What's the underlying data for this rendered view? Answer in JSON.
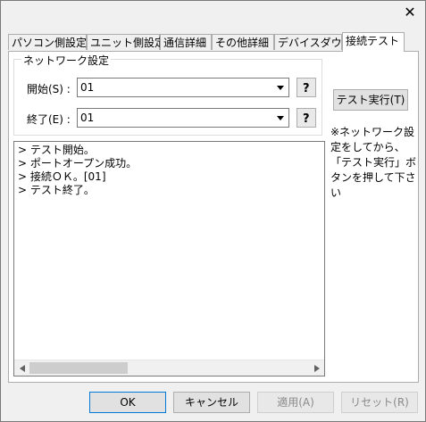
{
  "window": {
    "close_label": "✕"
  },
  "tabs": [
    {
      "label": "パソコン側設定"
    },
    {
      "label": "ユニット側設定"
    },
    {
      "label": "通信詳細"
    },
    {
      "label": "その他詳細"
    },
    {
      "label": "デバイスダウン"
    },
    {
      "label": "接続テスト"
    }
  ],
  "network": {
    "title": "ネットワーク設定",
    "start_label": "開始(S) :",
    "start_value": "01",
    "end_label": "終了(E) :",
    "end_value": "01"
  },
  "test_button": "テスト実行(T)",
  "note": "※ネットワーク設定をしてから、「テスト実行」ボタンを押して下さい",
  "log": [
    "> テスト開始。",
    "> ポートオープン成功。",
    "> 接続ＯＫ。[01]",
    "> テスト終了。"
  ],
  "footer": {
    "ok": "OK",
    "cancel": "キャンセル",
    "apply": "適用(A)",
    "reset": "リセット(R)"
  },
  "colors": {
    "default_button_border": "#0078d7",
    "disabled_text": "#8a8a8a"
  }
}
